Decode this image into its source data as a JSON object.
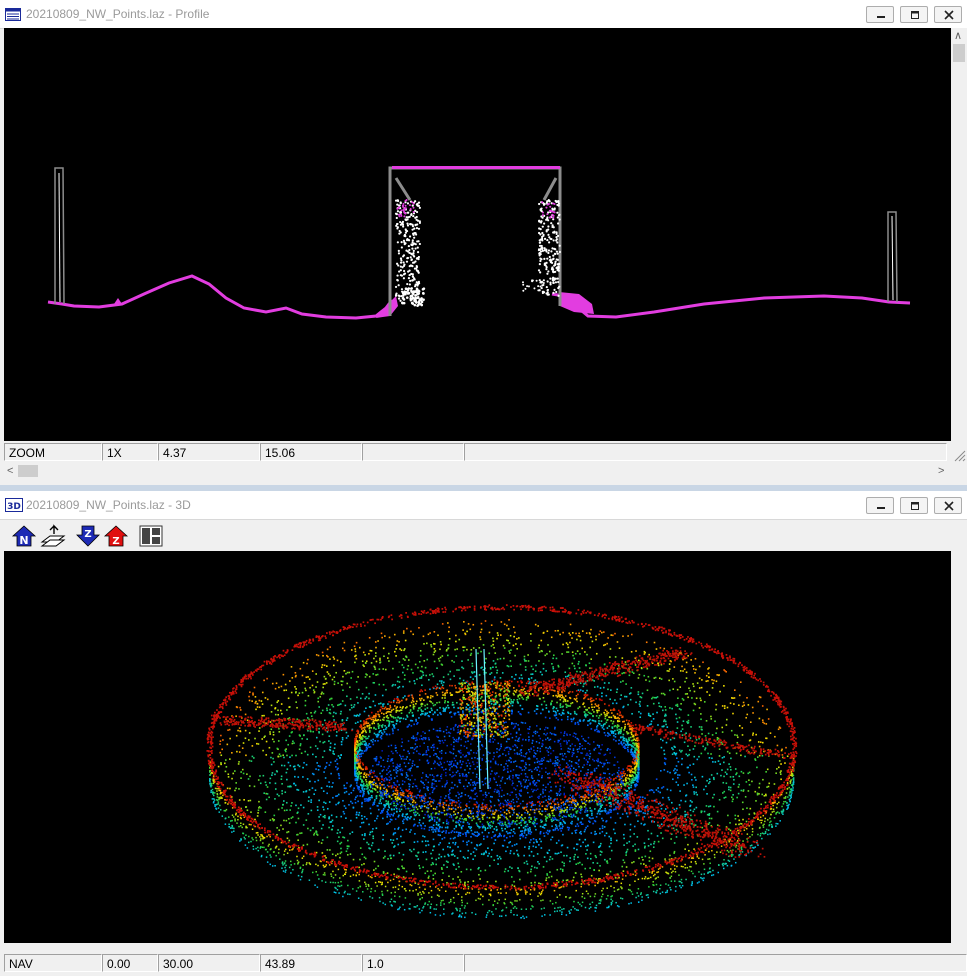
{
  "profile_window": {
    "title": "20210809_NW_Points.laz - Profile",
    "status": {
      "mode": "ZOOM",
      "zoom": "1X",
      "field_a": "4.37",
      "field_b": "15.06"
    }
  },
  "view3d_window": {
    "title": "20210809_NW_Points.laz - 3D",
    "icon_text": "3D",
    "toolbar": [
      {
        "id": "north-view",
        "icon": "north-arrow-icon"
      },
      {
        "id": "tilt-view",
        "icon": "tilt-plane-icon"
      },
      {
        "id": "z-down",
        "icon": "z-down-arrow-icon"
      },
      {
        "id": "z-up",
        "icon": "z-up-arrow-icon"
      },
      {
        "id": "panels",
        "icon": "panel-layout-icon"
      }
    ],
    "toolbar_letters": {
      "north": "N",
      "z": "Z"
    },
    "status": {
      "mode": "NAV",
      "v1": "0.00",
      "v2": "30.00",
      "v3": "43.89",
      "v4": "1.0"
    }
  },
  "colors": {
    "ground": "#e23de0",
    "structure": "#ffffff",
    "structure_gray": "#8c8c8c",
    "viewport_bg": "#000000",
    "window_bg": "#f0f0f0"
  }
}
